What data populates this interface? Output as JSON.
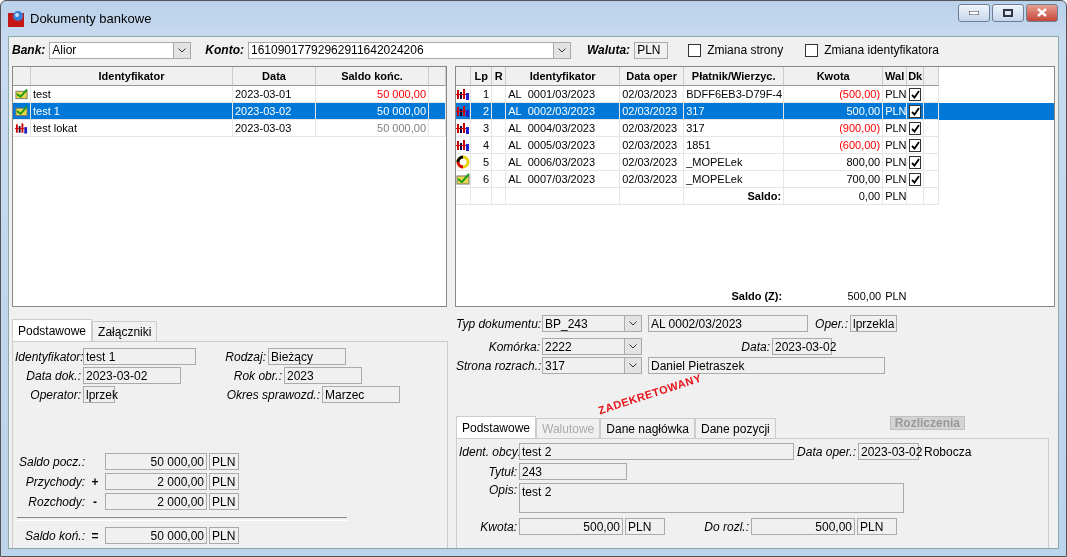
{
  "window": {
    "title": "Dokumenty bankowe"
  },
  "filters": {
    "bank_label": "Bank:",
    "bank": "Alior",
    "account_label": "Konto:",
    "account": "16109017792962911642024206",
    "currency_label": "Waluta:",
    "currency": "PLN",
    "checkboxes": [
      {
        "label": "Zmiana strony",
        "checked": false
      },
      {
        "label": "Zmiana identyfikatora",
        "checked": false
      }
    ]
  },
  "statements": {
    "columns": [
      "Identyfikator",
      "Data",
      "Saldo końc."
    ],
    "rows": [
      {
        "kind": "check",
        "id": "test",
        "date": "2023-03-01",
        "balance": "50 000,00",
        "muted": false,
        "selected": false
      },
      {
        "kind": "check",
        "id": "test 1",
        "date": "2023-03-02",
        "balance": "50 000,00",
        "selected": true
      },
      {
        "kind": "people",
        "id": "test lokat",
        "date": "2023-03-03",
        "balance": "50 000,00",
        "muted": true,
        "selected": false
      }
    ]
  },
  "entries": {
    "columns": [
      "Lp",
      "R",
      "Identyfikator",
      "Data oper",
      "Płatnik/Wierzyc.",
      "Kwota",
      "Wal",
      "Dk"
    ],
    "rows": [
      {
        "kind": "people",
        "lp": "1",
        "series": "AL",
        "number": "0001/03/2023",
        "date": "02/03/2023",
        "party": "BDFF6EB3-D79F-4",
        "amount": "(500,00)",
        "negative": true,
        "currency": "PLN",
        "dk": true,
        "selected": false
      },
      {
        "kind": "people",
        "lp": "2",
        "series": "AL",
        "number": "0002/03/2023",
        "date": "02/03/2023",
        "party": "317",
        "amount": "500,00",
        "negative": false,
        "currency": "PLN",
        "dk": true,
        "selected": true
      },
      {
        "kind": "people",
        "lp": "3",
        "series": "AL",
        "number": "0004/03/2023",
        "date": "02/03/2023",
        "party": "317",
        "amount": "(900,00)",
        "negative": true,
        "currency": "PLN",
        "dk": true,
        "selected": false
      },
      {
        "kind": "people",
        "lp": "4",
        "series": "AL",
        "number": "0005/03/2023",
        "date": "02/03/2023",
        "party": "1851",
        "amount": "(600,00)",
        "negative": true,
        "currency": "PLN",
        "dk": true,
        "selected": false
      },
      {
        "kind": "ring",
        "lp": "5",
        "series": "AL",
        "number": "0006/03/2023",
        "date": "02/03/2023",
        "party": "_MOPELek",
        "amount": "800,00",
        "negative": false,
        "currency": "PLN",
        "dk": true,
        "selected": false
      },
      {
        "kind": "check",
        "lp": "6",
        "series": "AL",
        "number": "0007/03/2023",
        "date": "02/03/2023",
        "party": "_MOPELek",
        "amount": "700,00",
        "negative": false,
        "currency": "PLN",
        "dk": true,
        "selected": false
      }
    ],
    "summary": {
      "label": "Saldo:",
      "amount": "0,00",
      "currency": "PLN"
    },
    "footer": {
      "label": "Saldo (Z):",
      "amount": "500,00",
      "currency": "PLN"
    }
  },
  "statement_details": {
    "tabs": [
      {
        "label": "Podstawowe",
        "selected": true
      },
      {
        "label": "Załączniki",
        "selected": false
      }
    ],
    "fields": [
      {
        "label": "Identyfikator:",
        "value": "test 1"
      },
      {
        "label": "Rodzaj:",
        "value": "Bieżący"
      },
      {
        "label": "Data dok.:",
        "value": "2023-03-02"
      },
      {
        "label": "Rok obr.:",
        "value": "2023"
      },
      {
        "label": "Operator:",
        "value": "lprzek"
      },
      {
        "label": "Okres sprawozd.:",
        "value": "Marzec"
      }
    ],
    "balances": [
      {
        "label": "Saldo pocz.:",
        "amount": "50 000,00",
        "currency": "PLN"
      },
      {
        "label": "Przychody:",
        "sign": "+",
        "amount": "2 000,00",
        "currency": "PLN"
      },
      {
        "label": "Rozchody:",
        "sign": "-",
        "amount": "2 000,00",
        "currency": "PLN"
      },
      {
        "label": "Saldo koń.:",
        "sign": "=",
        "amount": "50 000,00",
        "currency": "PLN"
      }
    ]
  },
  "document": {
    "type_label": "Typ dokumentu:",
    "type": "BP_243",
    "number": "AL  0002/03/2023",
    "operator_label": "Oper.:",
    "operator": "lprzekla",
    "cell_label": "Komórka:",
    "cell": "2222",
    "date_label": "Data:",
    "date": "2023-03-02",
    "party_label": "Strona rozrach.:",
    "party_code": "317",
    "party_name": "Daniel Pietraszek",
    "stamp": "ZADEKRETOWANY",
    "tabs": [
      {
        "label": "Podstawowe",
        "selected": true,
        "disabled": false
      },
      {
        "label": "Walutowe",
        "selected": false,
        "disabled": true
      },
      {
        "label": "Dane nagłówka",
        "selected": false,
        "disabled": false
      },
      {
        "label": "Dane pozycji",
        "selected": false,
        "disabled": false
      }
    ],
    "settlements_button": {
      "label": "Rozliczenia",
      "disabled": true
    },
    "foreign_id_label": "Ident. obcy:",
    "foreign_id": "test 2",
    "op_date_label": "Data oper.:",
    "op_date": "2023-03-02",
    "status": "Robocza",
    "title_label": "Tytuł:",
    "title": "243",
    "description_label": "Opis:",
    "description": "test 2",
    "amount_label": "Kwota:",
    "amount": "500,00",
    "amount_currency": "PLN",
    "to_settle_label": "Do rozl.:",
    "to_settle": "500,00",
    "to_settle_currency": "PLN"
  }
}
